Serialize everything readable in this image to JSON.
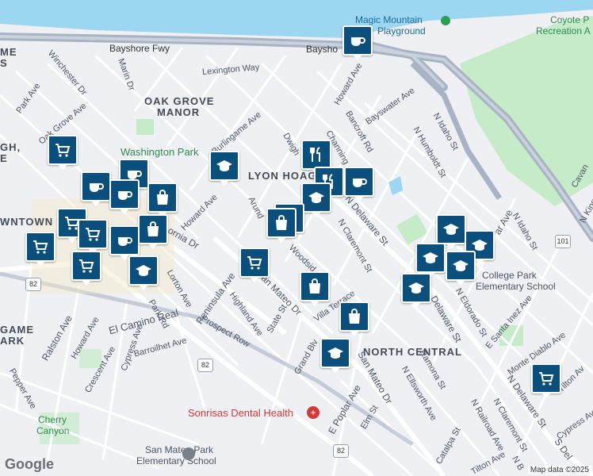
{
  "map": {
    "attribution": "Map data ©2025",
    "brand": "Google",
    "colors": {
      "background": "#eef0f4",
      "water": "#9dd6f0",
      "park": "#c6ebc9",
      "freeway": "#a8b3c3",
      "road": "#ffffff",
      "marker": "#0b4f7d"
    }
  },
  "areas": {
    "oak_grove_1": "OAK GROVE",
    "oak_grove_2": "MANOR",
    "lyon_hoag": "LYON HOAG",
    "north_central": "NORTH CENTRAL",
    "downtown": "WNTOWN",
    "burlingame_1": "GAME",
    "burlingame_2": "ARK",
    "edge_top_left_1": "ME",
    "edge_top_left_2": "S",
    "edge_left_1": "GH,",
    "edge_left_2": "E"
  },
  "pois": {
    "magic_mountain_1": "Magic Mountain",
    "magic_mountain_2": "Playground",
    "coyote_1": "Coyote P",
    "coyote_2": "Recreation A",
    "washington_park": "Washington Park",
    "college_park_1": "College Park",
    "college_park_2": "Elementary School",
    "sonrisas": "Sonrisas Dental Health",
    "cherry_1": "Cherry",
    "cherry_2": "Canyon",
    "smp_1": "San Mateo Park",
    "smp_2": "Elementary School"
  },
  "streets": {
    "bayshore_fwy": "Bayshore Fwy",
    "bayshore": "Baysho",
    "winchester": "Winchester Dr",
    "marin": "Marin Dr",
    "park_ave": "Park Ave",
    "lexington": "Lexington Way",
    "howard_top": "Howard Ave",
    "bayswater": "Bayswater Ave",
    "oak_grove_ave": "Oak Grove Ave",
    "burlingame_ave": "Burlingame Ave",
    "dwight": "Dwigh",
    "bancroft": "Bancroft Rd",
    "channing": "Channing",
    "n_idaho_1": "N Idaho St",
    "n_humboldt": "N Humboldt St",
    "howard_mid": "Howard Ave",
    "arundel": "Arund",
    "california": "ornia Dr",
    "n_delaware": "N Delaware St",
    "n_claremont": "N Claremont St",
    "woodside": "Woodsid",
    "n_idaho_2": "N Idaho St",
    "ar_ave": "ar Ave",
    "lorton": "Lorton Ave",
    "peninsula": "Peninsula Ave",
    "san_mateo_dr": "an Mateo Dr",
    "highland": "Highland Ave",
    "state": "State St",
    "villa": "Villa Terrace",
    "park_rd": "Park Rd",
    "el_camino": "El Camino Real",
    "ralston": "Ralston Ave",
    "howard_low": "Howard Ave",
    "crescent": "Crescent Ave",
    "cypress": "Cypress Ave",
    "barroilhet": "Barroilhet Ave",
    "prospect": "Prospect Row",
    "grand": "Grand Blv",
    "san_mateo_dr_2": "San Mateo Dr",
    "delaware_2": "Delaware St",
    "n_eldorado": "N Eldorado St",
    "e_santa_inez": "E Santa Inez Ave",
    "monte_diablo": "Monte Diablo Ave",
    "tilton_1": "Tilton Av",
    "ramona": "Ramona St",
    "n_ellsworth": "N Ellsworth Ave",
    "e_poplar": "E Poplar Ave",
    "elm": "Elm St",
    "n_delaware_3": "N Delaware St",
    "s_del": "S Del",
    "n_claremont_2": "N Claremont St",
    "n_railroad": "N Railroad Ave",
    "catalpa": "Catalpa St",
    "tilton_2": "Tilton Ave",
    "n_b": "N B",
    "cypress_2": "Cypress Ave",
    "pepper": "Pepper Ave",
    "cavan": "Cavan",
    "n_king": "N King",
    "shield_82a": "82",
    "shield_82b": "82",
    "shield_82c": "82",
    "shield_101": "101"
  },
  "markers": [
    {
      "icon": "coffee-icon"
    },
    {
      "icon": "grocery-cart-icon"
    },
    {
      "icon": "school-icon"
    },
    {
      "icon": "restaurant-icon"
    },
    {
      "icon": "restaurant-icon"
    },
    {
      "icon": "coffee-icon"
    },
    {
      "icon": "coffee-icon"
    },
    {
      "icon": "school-icon"
    },
    {
      "icon": "restaurant-icon"
    },
    {
      "icon": "shopping-bag-icon"
    },
    {
      "icon": "grocery-cart-icon"
    },
    {
      "icon": "shopping-bag-icon"
    },
    {
      "icon": "shopping-bag-icon"
    },
    {
      "icon": "school-icon"
    },
    {
      "icon": "school-icon"
    },
    {
      "icon": "school-icon"
    },
    {
      "icon": "school-icon"
    },
    {
      "icon": "school-icon"
    },
    {
      "icon": "school-icon"
    },
    {
      "icon": "grocery-cart-icon"
    },
    {
      "icon": "coffee-icon"
    },
    {
      "icon": "coffee-icon"
    },
    {
      "icon": "shopping-bag-icon"
    },
    {
      "icon": "grocery-cart-icon"
    },
    {
      "icon": "grocery-cart-icon"
    },
    {
      "icon": "grocery-cart-icon"
    },
    {
      "icon": "coffee-icon"
    },
    {
      "icon": "shopping-bag-icon"
    },
    {
      "icon": "grocery-cart-icon"
    },
    {
      "icon": "school-icon"
    }
  ]
}
